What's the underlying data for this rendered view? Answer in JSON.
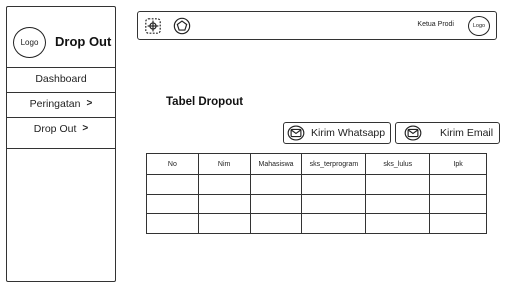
{
  "sidebar": {
    "logo_text": "Logo",
    "title": "Drop Out",
    "items": [
      {
        "label": "Dashboard",
        "chevron": ""
      },
      {
        "label": "Peringatan",
        "chevron": ">"
      },
      {
        "label": "Drop Out",
        "chevron": ">"
      }
    ]
  },
  "topbar": {
    "icons": [
      "crosshair-icon",
      "pentagon-icon"
    ],
    "user_role": "Ketua Prodi",
    "user_logo_text": "Logo"
  },
  "main": {
    "title": "Tabel Dropout",
    "whatsapp_button": "Kirim Whatsapp",
    "email_button": "Kirim Email"
  },
  "table": {
    "columns": [
      "No",
      "Nim",
      "Mahasiswa",
      "sks_terprogram",
      "sks_lulus",
      "Ipk"
    ],
    "rows": [
      [
        "",
        "",
        "",
        "",
        "",
        ""
      ],
      [
        "",
        "",
        "",
        "",
        "",
        ""
      ],
      [
        "",
        "",
        "",
        "",
        "",
        ""
      ]
    ]
  },
  "colors": {
    "border": "#333333",
    "background": "#ffffff",
    "text": "#111111"
  }
}
